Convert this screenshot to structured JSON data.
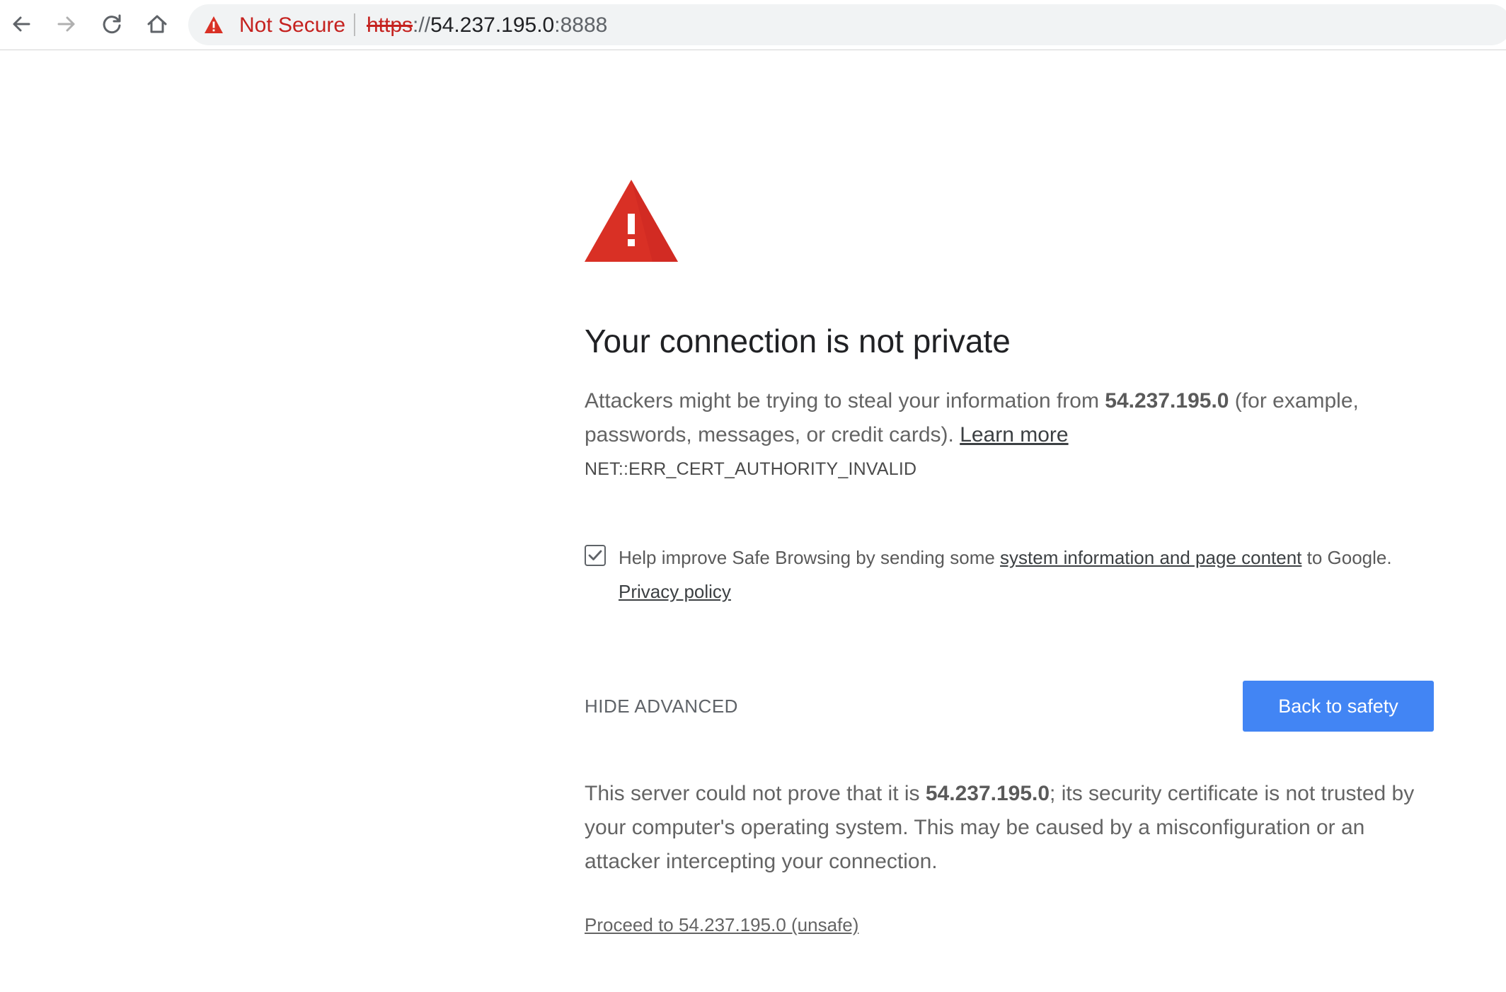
{
  "browser": {
    "security_label": "Not Secure",
    "url": {
      "scheme": "https",
      "separator": "://",
      "host": "54.237.195.0",
      "port": ":8888"
    }
  },
  "interstitial": {
    "heading": "Your connection is not private",
    "main_message": {
      "before": "Attackers might be trying to steal your information from ",
      "host": "54.237.195.0",
      "after": " (for example, passwords, messages, or credit cards). ",
      "learn_more": "Learn more"
    },
    "error_code": "NET::ERR_CERT_AUTHORITY_INVALID",
    "safe_browsing": {
      "checked": true,
      "before": "Help improve Safe Browsing by sending some ",
      "link": "system information and page content",
      "after": " to Google. ",
      "privacy_policy": "Privacy policy"
    },
    "hide_advanced_label": "HIDE ADVANCED",
    "back_button_label": "Back to safety",
    "details": {
      "before": "This server could not prove that it is ",
      "host": "54.237.195.0",
      "after": "; its security certificate is not trusted by your computer's operating system. This may be caused by a misconfiguration or an attacker intercepting your connection."
    },
    "proceed_link": "Proceed to 54.237.195.0 (unsafe)"
  },
  "colors": {
    "danger": "#d93025",
    "primary_button": "#4285f4",
    "body_text": "#646464"
  },
  "icons": {
    "back": "arrow-left-icon",
    "forward": "arrow-right-icon",
    "reload": "reload-icon",
    "home": "home-icon",
    "security_warning": "warning-triangle-icon",
    "page_warning": "warning-triangle-icon",
    "checkbox": "checkmark-icon"
  }
}
